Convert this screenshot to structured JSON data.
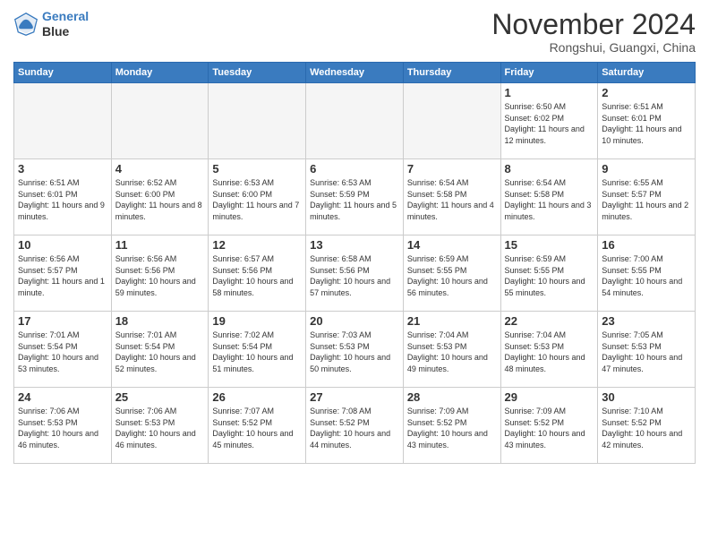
{
  "logo": {
    "line1": "General",
    "line2": "Blue"
  },
  "header": {
    "month": "November 2024",
    "location": "Rongshui, Guangxi, China"
  },
  "weekdays": [
    "Sunday",
    "Monday",
    "Tuesday",
    "Wednesday",
    "Thursday",
    "Friday",
    "Saturday"
  ],
  "weeks": [
    [
      {
        "day": "",
        "empty": true
      },
      {
        "day": "",
        "empty": true
      },
      {
        "day": "",
        "empty": true
      },
      {
        "day": "",
        "empty": true
      },
      {
        "day": "",
        "empty": true
      },
      {
        "day": "1",
        "sunrise": "6:50 AM",
        "sunset": "6:02 PM",
        "daylight": "11 hours and 12 minutes."
      },
      {
        "day": "2",
        "sunrise": "6:51 AM",
        "sunset": "6:01 PM",
        "daylight": "11 hours and 10 minutes."
      }
    ],
    [
      {
        "day": "3",
        "sunrise": "6:51 AM",
        "sunset": "6:01 PM",
        "daylight": "11 hours and 9 minutes."
      },
      {
        "day": "4",
        "sunrise": "6:52 AM",
        "sunset": "6:00 PM",
        "daylight": "11 hours and 8 minutes."
      },
      {
        "day": "5",
        "sunrise": "6:53 AM",
        "sunset": "6:00 PM",
        "daylight": "11 hours and 7 minutes."
      },
      {
        "day": "6",
        "sunrise": "6:53 AM",
        "sunset": "5:59 PM",
        "daylight": "11 hours and 5 minutes."
      },
      {
        "day": "7",
        "sunrise": "6:54 AM",
        "sunset": "5:58 PM",
        "daylight": "11 hours and 4 minutes."
      },
      {
        "day": "8",
        "sunrise": "6:54 AM",
        "sunset": "5:58 PM",
        "daylight": "11 hours and 3 minutes."
      },
      {
        "day": "9",
        "sunrise": "6:55 AM",
        "sunset": "5:57 PM",
        "daylight": "11 hours and 2 minutes."
      }
    ],
    [
      {
        "day": "10",
        "sunrise": "6:56 AM",
        "sunset": "5:57 PM",
        "daylight": "11 hours and 1 minute."
      },
      {
        "day": "11",
        "sunrise": "6:56 AM",
        "sunset": "5:56 PM",
        "daylight": "10 hours and 59 minutes."
      },
      {
        "day": "12",
        "sunrise": "6:57 AM",
        "sunset": "5:56 PM",
        "daylight": "10 hours and 58 minutes."
      },
      {
        "day": "13",
        "sunrise": "6:58 AM",
        "sunset": "5:56 PM",
        "daylight": "10 hours and 57 minutes."
      },
      {
        "day": "14",
        "sunrise": "6:59 AM",
        "sunset": "5:55 PM",
        "daylight": "10 hours and 56 minutes."
      },
      {
        "day": "15",
        "sunrise": "6:59 AM",
        "sunset": "5:55 PM",
        "daylight": "10 hours and 55 minutes."
      },
      {
        "day": "16",
        "sunrise": "7:00 AM",
        "sunset": "5:55 PM",
        "daylight": "10 hours and 54 minutes."
      }
    ],
    [
      {
        "day": "17",
        "sunrise": "7:01 AM",
        "sunset": "5:54 PM",
        "daylight": "10 hours and 53 minutes."
      },
      {
        "day": "18",
        "sunrise": "7:01 AM",
        "sunset": "5:54 PM",
        "daylight": "10 hours and 52 minutes."
      },
      {
        "day": "19",
        "sunrise": "7:02 AM",
        "sunset": "5:54 PM",
        "daylight": "10 hours and 51 minutes."
      },
      {
        "day": "20",
        "sunrise": "7:03 AM",
        "sunset": "5:53 PM",
        "daylight": "10 hours and 50 minutes."
      },
      {
        "day": "21",
        "sunrise": "7:04 AM",
        "sunset": "5:53 PM",
        "daylight": "10 hours and 49 minutes."
      },
      {
        "day": "22",
        "sunrise": "7:04 AM",
        "sunset": "5:53 PM",
        "daylight": "10 hours and 48 minutes."
      },
      {
        "day": "23",
        "sunrise": "7:05 AM",
        "sunset": "5:53 PM",
        "daylight": "10 hours and 47 minutes."
      }
    ],
    [
      {
        "day": "24",
        "sunrise": "7:06 AM",
        "sunset": "5:53 PM",
        "daylight": "10 hours and 46 minutes."
      },
      {
        "day": "25",
        "sunrise": "7:06 AM",
        "sunset": "5:53 PM",
        "daylight": "10 hours and 46 minutes."
      },
      {
        "day": "26",
        "sunrise": "7:07 AM",
        "sunset": "5:52 PM",
        "daylight": "10 hours and 45 minutes."
      },
      {
        "day": "27",
        "sunrise": "7:08 AM",
        "sunset": "5:52 PM",
        "daylight": "10 hours and 44 minutes."
      },
      {
        "day": "28",
        "sunrise": "7:09 AM",
        "sunset": "5:52 PM",
        "daylight": "10 hours and 43 minutes."
      },
      {
        "day": "29",
        "sunrise": "7:09 AM",
        "sunset": "5:52 PM",
        "daylight": "10 hours and 43 minutes."
      },
      {
        "day": "30",
        "sunrise": "7:10 AM",
        "sunset": "5:52 PM",
        "daylight": "10 hours and 42 minutes."
      }
    ]
  ]
}
